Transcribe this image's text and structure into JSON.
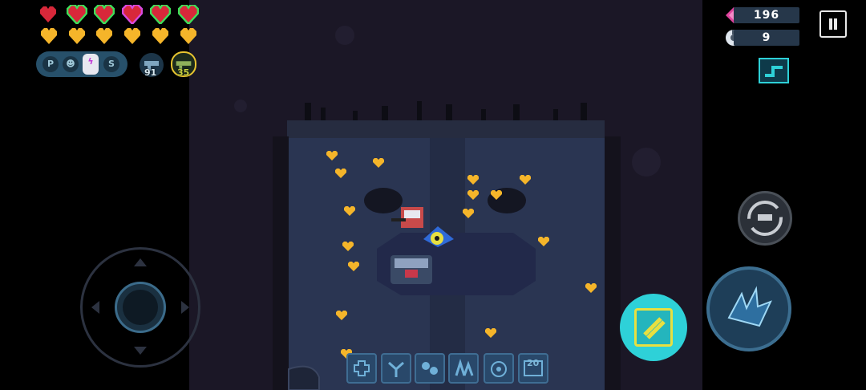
{
  "hud": {
    "health_hearts": [
      "red",
      "red-green",
      "red-green",
      "red-purple",
      "red-green",
      "red-green"
    ],
    "armor_hearts": [
      "gold",
      "gold",
      "gold",
      "gold",
      "gold",
      "gold"
    ],
    "skill_slots": [
      "P",
      "",
      "",
      "S"
    ],
    "weapon_ammo_1": "91",
    "weapon_ammo_2": "35",
    "gems": "196",
    "parts": "9"
  },
  "controls": {
    "buff_count": "20"
  },
  "colors": {
    "accent_cyan": "#2ed1d8",
    "gem_pink": "#e0449e",
    "heart_red": "#d8283a",
    "heart_gold": "#f5b52a",
    "floor": "#2a3552"
  },
  "icons": {
    "pause": "pause-icon",
    "minimap": "minimap-icon",
    "gem": "gem-icon",
    "part": "part-icon",
    "weapon_swap": "weapon-swap-icon",
    "skill": "skill-icon",
    "attack": "attack-icon"
  }
}
